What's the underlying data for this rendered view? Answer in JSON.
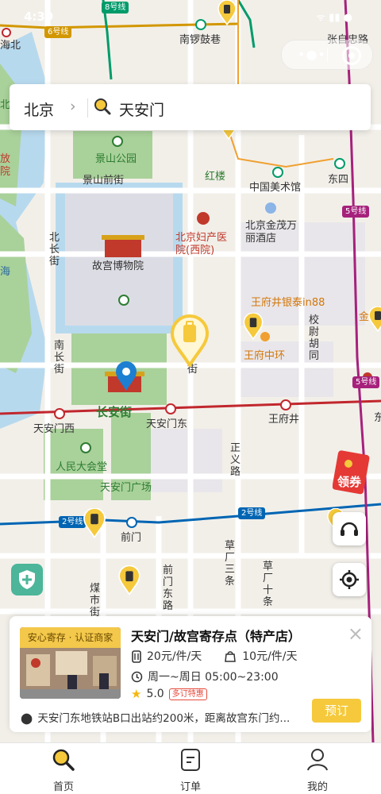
{
  "status_bar": {
    "time": "4:39",
    "icons": "ᯤ ▮▮ ●"
  },
  "search": {
    "city": "北京",
    "chevron": "›",
    "query": "天安门"
  },
  "map": {
    "metro_lines": {
      "l2": "2号线",
      "l5": "5号线",
      "l6": "6号线",
      "l8": "8号线"
    },
    "labels": {
      "haibei": "海北",
      "nanluoguxiang": "南锣鼓巷",
      "zhangzizhonglu": "张自忠路",
      "bei": "北",
      "fang": "放",
      "yuan": "院",
      "jingshan": "景山公园",
      "jingshanqianjie": "景山前街",
      "honglou": "红楼",
      "meishuguan": "中国美术馆",
      "dongsi": "东四",
      "gugong": "故宫博物院",
      "fuchan": "北京妇产医院(西院)",
      "jinmao": "北京金茂万丽酒店",
      "beichangjie": "北长街",
      "hai": "海",
      "wangfujing_yintai": "王府井银泰in88",
      "xiaowei": "校尉胡同",
      "jin": "金",
      "nanchangjie": "南长街",
      "jie": "街",
      "wangfu_zhonghuan": "王府中环",
      "changanjie": "长安街",
      "tiananmenxi": "天安门西",
      "tiananmendong": "天安门东",
      "wangfujing": "王府井",
      "dong": "东",
      "renmin": "人民大会堂",
      "zhengyi": "正义路",
      "guangchang": "天安门广场",
      "qianmen": "前门",
      "caochangsantiao": "草厂三条",
      "caochangshitiao": "草厂十条",
      "qianmendongjie": "前门东路",
      "meishijie": "煤市街"
    }
  },
  "coupon": {
    "label": "领券"
  },
  "store": {
    "badge": "安心寄存 · 认证商家",
    "title": "天安门/故宫寄存点（特产店）",
    "price_large": "20元/件/天",
    "price_small": "10元/件/天",
    "hours": "周一~周日 05:00~23:00",
    "rating": "5.0",
    "promo_tag": "多订特惠",
    "address": "天安门东地铁站B口出站约200米，距离故宫东门约...",
    "book_label": "预订",
    "close": "×"
  },
  "tabs": [
    {
      "label": "首页",
      "icon": "search-icon"
    },
    {
      "label": "订单",
      "icon": "order-icon"
    },
    {
      "label": "我的",
      "icon": "profile-icon"
    }
  ],
  "colors": {
    "accent": "#f5c93b",
    "line1": "#c1272d",
    "line2": "#0065b3",
    "line5": "#a6217c",
    "line6": "#d29700",
    "line8": "#009b6b"
  }
}
